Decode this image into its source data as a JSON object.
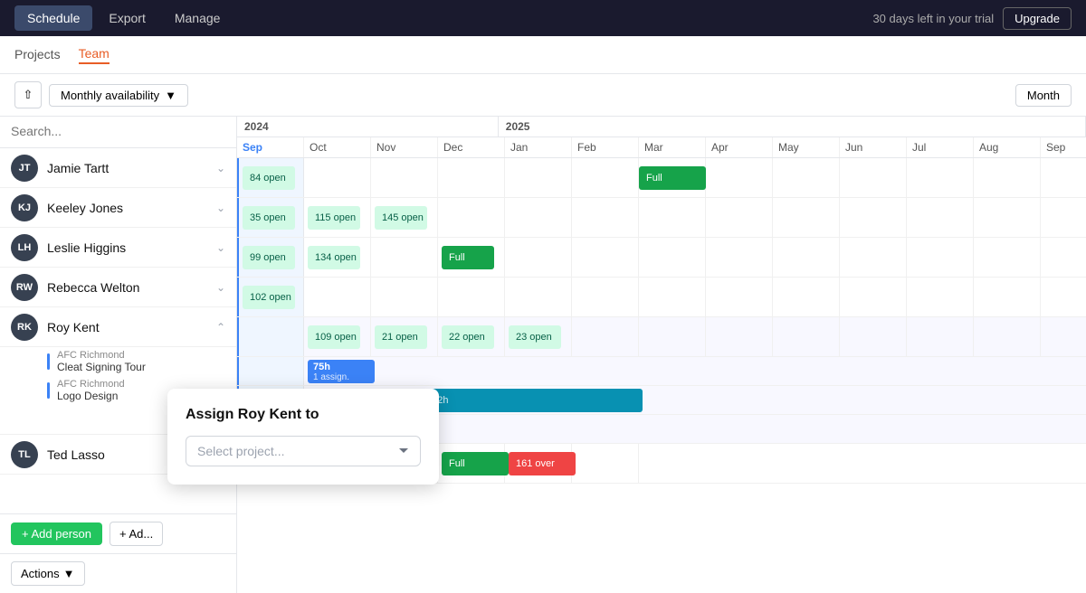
{
  "nav": {
    "tabs": [
      "Schedule",
      "Export",
      "Manage"
    ],
    "active_tab": "Schedule",
    "trial_text": "30 days left in your trial",
    "upgrade_btn": "Upgrade"
  },
  "sub_nav": {
    "tabs": [
      "Projects",
      "Team"
    ],
    "active_tab": "Team"
  },
  "toolbar": {
    "view_dropdown": "Monthly availability",
    "month_btn": "Month"
  },
  "search": {
    "placeholder": "Search..."
  },
  "team": [
    {
      "id": "JT",
      "name": "Jamie Tartt",
      "color": "#374151"
    },
    {
      "id": "KJ",
      "name": "Keeley Jones",
      "color": "#374151"
    },
    {
      "id": "LH",
      "name": "Leslie Higgins",
      "color": "#374151"
    },
    {
      "id": "RW",
      "name": "Rebecca Welton",
      "color": "#374151"
    },
    {
      "id": "RK",
      "name": "Roy Kent",
      "color": "#374151",
      "expanded": true
    },
    {
      "id": "TL",
      "name": "Ted Lasso",
      "color": "#374151"
    }
  ],
  "roy_kent_projects": [
    {
      "label": "AFC Richmond",
      "name": "Cleat Signing Tour"
    },
    {
      "label": "AFC Richmond",
      "name": "Logo Design"
    }
  ],
  "months_2024": [
    "Sep",
    "Oct",
    "Nov",
    "Dec"
  ],
  "months_2025": [
    "Jan",
    "Feb",
    "Mar",
    "Apr",
    "May",
    "Jun",
    "Jul",
    "Aug",
    "Sep"
  ],
  "year_2024": "2024",
  "year_2025": "2025",
  "actions_btn": "Actions",
  "add_person_btn": "+ Add person",
  "add_placeholder_btn": "+ Ad...",
  "modal": {
    "title": "Assign Roy Kent to",
    "select_placeholder": "Select project..."
  }
}
